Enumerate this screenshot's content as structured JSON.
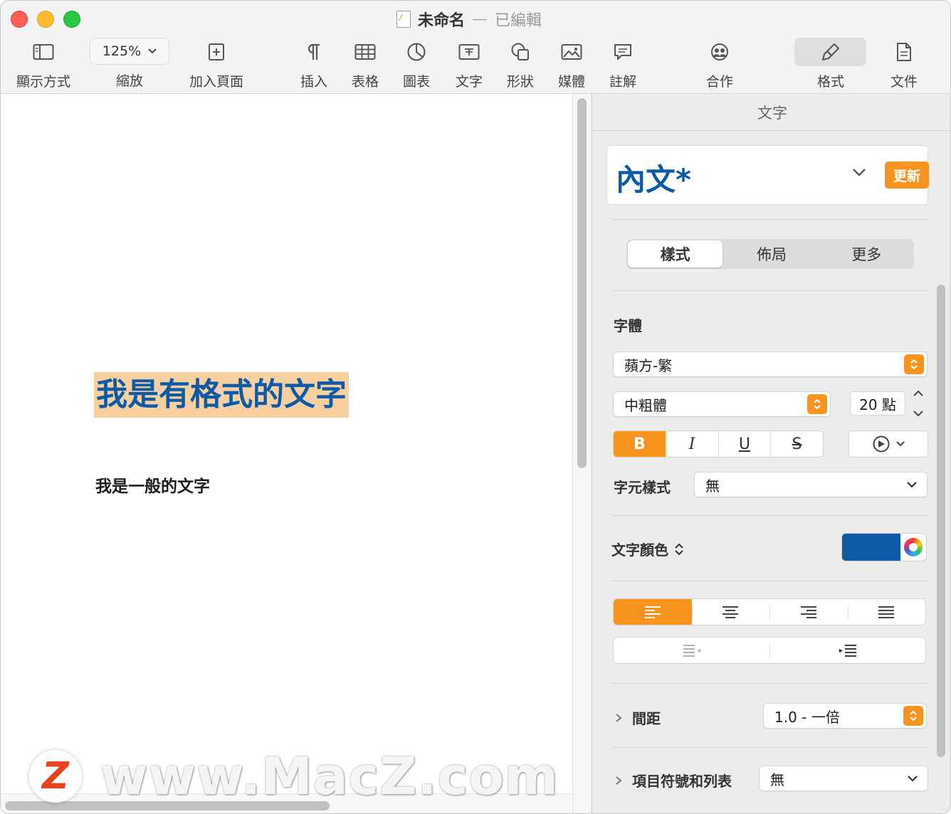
{
  "window": {
    "title": "未命名",
    "separator": "—",
    "status": "已編輯"
  },
  "toolbar": {
    "view_label": "顯示方式",
    "zoom_value": "125%",
    "zoom_label": "縮放",
    "add_page_label": "加入頁面",
    "insert_label": "插入",
    "table_label": "表格",
    "chart_label": "圖表",
    "text_label": "文字",
    "shape_label": "形狀",
    "media_label": "媒體",
    "comment_label": "註解",
    "collaborate_label": "合作",
    "format_label": "格式",
    "document_label": "文件"
  },
  "document": {
    "formatted_text": "我是有格式的文字",
    "plain_text": "我是一般的文字"
  },
  "watermark": {
    "badge": "Z",
    "text": "www.MacZ.com"
  },
  "inspector": {
    "title": "文字",
    "paragraph_style": "內文*",
    "update_button": "更新",
    "tabs": [
      "樣式",
      "佈局",
      "更多"
    ],
    "font_section": "字體",
    "font_family": "蘋方-繁",
    "font_weight": "中粗體",
    "font_size": "20 點",
    "bold": "B",
    "italic": "I",
    "underline": "U",
    "strike": "S",
    "char_style_label": "字元樣式",
    "char_style_value": "無",
    "text_color_label": "文字顏色",
    "text_color": "#0d5aa7",
    "spacing_label": "間距",
    "spacing_value": "1.0 - 一倍",
    "bullets_label": "項目符號和列表",
    "bullets_value": "無"
  },
  "colors": {
    "accent": "#f7931e",
    "text_blue": "#0d5aa7",
    "highlight": "#f8cf9f"
  }
}
